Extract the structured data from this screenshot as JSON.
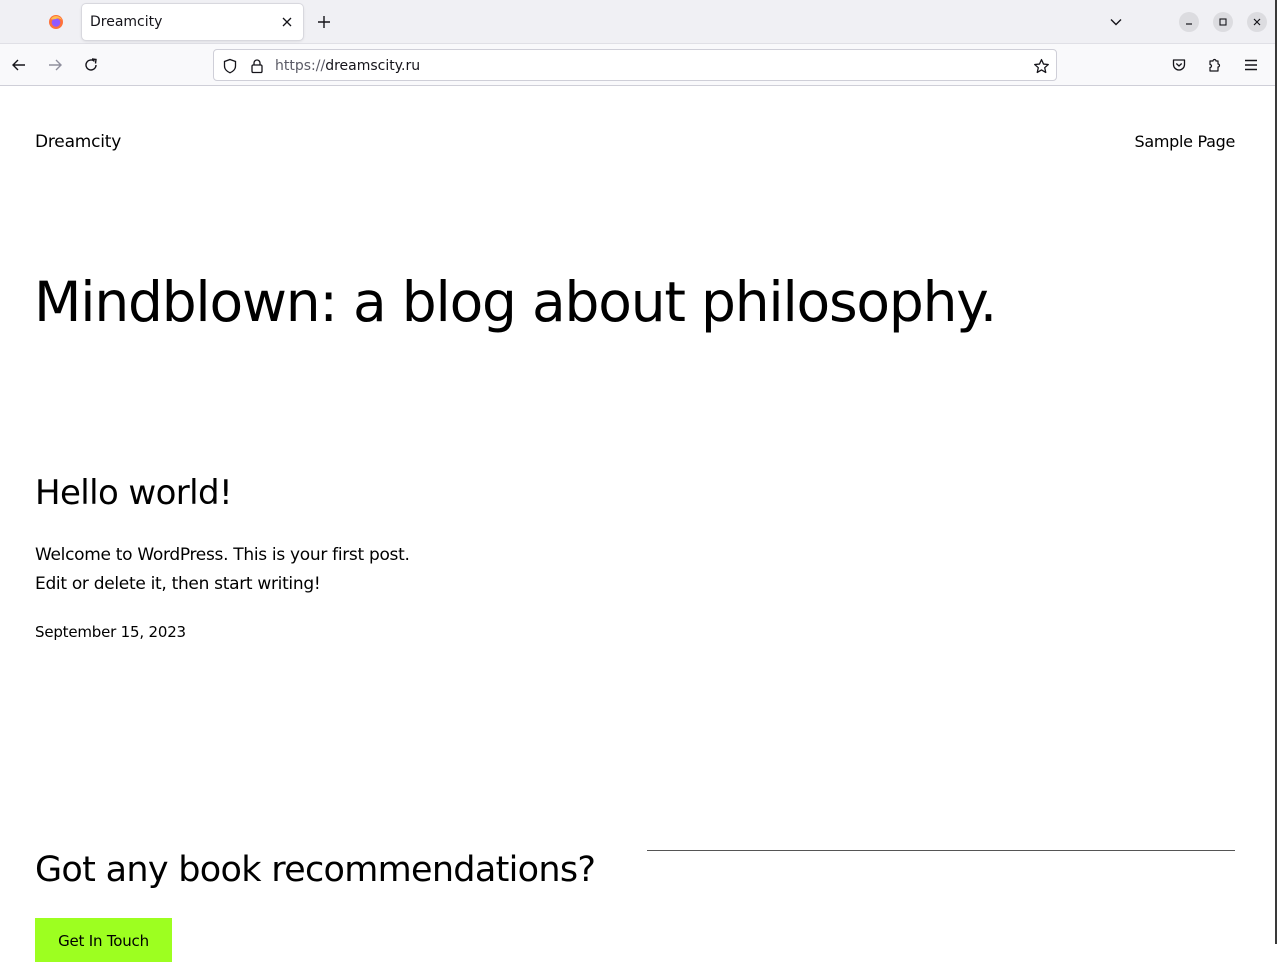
{
  "browser": {
    "tab_title": "Dreamcity",
    "url_scheme": "https://",
    "url_host": "dreamscity.ru",
    "icons": {
      "app": "firefox-icon",
      "tab_close": "close-icon",
      "new_tab": "plus-icon",
      "tab_list": "chevron-down-icon",
      "minimize": "minimize-icon",
      "maximize": "maximize-icon",
      "close_window": "close-icon",
      "back": "arrow-left-icon",
      "forward": "arrow-right-icon",
      "reload": "reload-icon",
      "tracking": "shield-icon",
      "lock": "lock-icon",
      "bookmark": "star-icon",
      "pocket": "pocket-icon",
      "extensions": "puzzle-icon",
      "menu": "hamburger-menu-icon"
    }
  },
  "site": {
    "title": "Dreamcity",
    "nav": [
      "Sample Page"
    ]
  },
  "hero": {
    "heading": "Mindblown: a blog about philosophy."
  },
  "posts": [
    {
      "title": "Hello world!",
      "excerpt_line1": "Welcome to WordPress. This is your first post.",
      "excerpt_line2": "Edit or delete it, then start writing!",
      "date": "September 15, 2023"
    }
  ],
  "cta": {
    "heading": "Got any book recommendations?",
    "button_label": "Get In Touch"
  },
  "colors": {
    "accent_button": "#9dff20",
    "text": "#000000",
    "chrome_tabbar": "#f0f0f4",
    "chrome_navbar": "#f9f9fb"
  }
}
